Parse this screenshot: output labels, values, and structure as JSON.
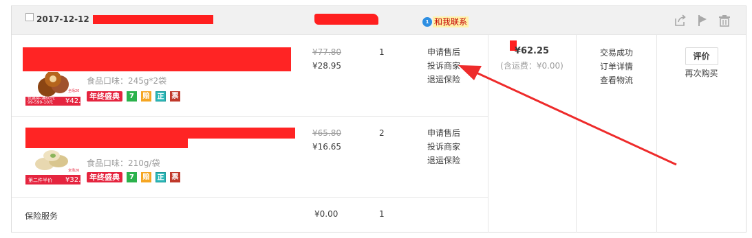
{
  "order": {
    "date": "2017-12-12",
    "contact_badge": "1",
    "contact_label": "和我联系",
    "op_icons": [
      "share-icon",
      "flag-icon",
      "trash-icon"
    ],
    "items": [
      {
        "flavor": "食品口味：245g*2袋",
        "price_old": "¥77.80",
        "price_now": "¥28.95",
        "qty": "1",
        "thumb_tag_top": "全场20",
        "thumb_tag_left": "优惠券-满60元\n99-599-10元",
        "thumb_price": "¥42.9",
        "promo": "年终盛典",
        "service_icons": [
          "7",
          "赔",
          "正",
          "票"
        ],
        "services": [
          "申请售后",
          "投诉商家",
          "退运保险"
        ]
      },
      {
        "flavor": "食品口味：210g/袋",
        "price_old": "¥65.80",
        "price_now": "¥16.65",
        "qty": "2",
        "thumb_tag_top": "全场26",
        "thumb_tag_left": "第二件半价",
        "thumb_price": "¥32.9",
        "promo": "年终盛典",
        "service_icons": [
          "7",
          "赔",
          "正",
          "票"
        ],
        "services": [
          "申请售后",
          "投诉商家",
          "退运保险"
        ]
      }
    ],
    "total": "¥62.25",
    "shipping": "(含运费：¥0.00)",
    "status": [
      "交易成功",
      "订单详情",
      "查看物流"
    ],
    "actions": {
      "evaluate": "评价",
      "rebuy": "再次购买"
    },
    "insurance": {
      "label": "保险服务",
      "price": "¥0.00",
      "qty": "1"
    }
  },
  "colors": {
    "redaction": "#ff1f1f",
    "header_bg": "#f1f1f1",
    "border": "#dcdcdc",
    "promo": "#e5253f"
  }
}
